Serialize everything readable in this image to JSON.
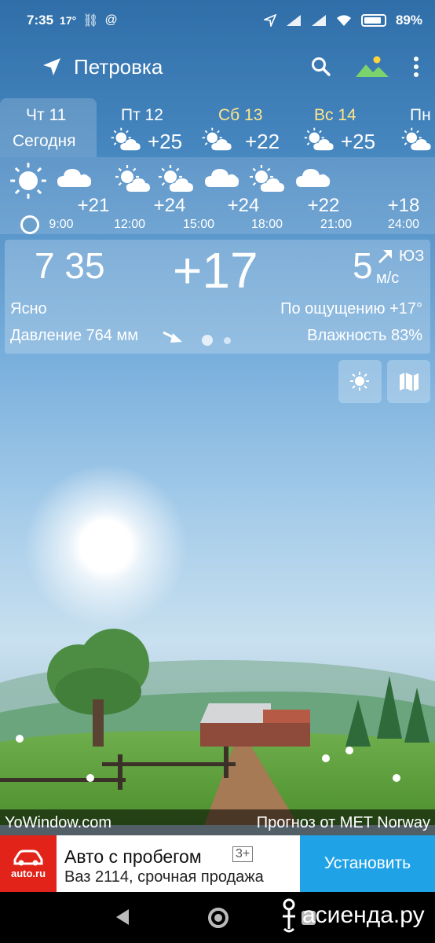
{
  "status_bar": {
    "time": "7:35",
    "temp": "17°",
    "battery": "89%",
    "battery_level": 0.89
  },
  "header": {
    "location": "Петровка",
    "nav_icon": "location-arrow-icon",
    "search_icon": "search-icon",
    "landscape_icon": "landscape-icon",
    "menu_icon": "more-vert-icon"
  },
  "days": [
    {
      "label": "Чт 11",
      "sub": "Сегодня",
      "weekend": false,
      "active": true
    },
    {
      "label": "Пт 12",
      "temp": "+25",
      "icon": "sun-cloud-icon",
      "weekend": false
    },
    {
      "label": "Сб 13",
      "temp": "+22",
      "icon": "sun-cloud-icon",
      "weekend": true
    },
    {
      "label": "Вс 14",
      "temp": "+25",
      "icon": "sun-cloud-icon",
      "weekend": true
    },
    {
      "label": "Пн",
      "icon": "sun-cloud-icon",
      "weekend": false
    }
  ],
  "hourly": [
    {
      "time": "9:00",
      "temp": "+21"
    },
    {
      "time": "12:00",
      "temp": "+24"
    },
    {
      "time": "15:00",
      "temp": "+24"
    },
    {
      "time": "18:00",
      "temp": "+22"
    },
    {
      "time": "21:00",
      "temp": "+18"
    },
    {
      "time": "24:00"
    }
  ],
  "current": {
    "time": "7 35",
    "temp": "+17",
    "wind_speed": "5",
    "wind_unit": "м/с",
    "wind_dir": "ЮЗ",
    "condition": "Ясно",
    "feels_like": "По ощущению +17°",
    "pressure": "Давление 764 мм",
    "humidity": "Влажность 83%"
  },
  "credits": {
    "left": "YoWindow.com",
    "right": "Прогноз от MET Norway"
  },
  "ad": {
    "logo_text": "auto.ru",
    "title": "Авто с пробегом",
    "age": "3+",
    "subtitle": "Ваз 2114, срочная продажа",
    "install": "Установить"
  },
  "watermark": "асиенда.ру",
  "colors": {
    "sky_top": "#2f6ea8",
    "weekend": "#ffe58a",
    "ad_red": "#e2231a",
    "ad_blue": "#1fa3e6"
  }
}
